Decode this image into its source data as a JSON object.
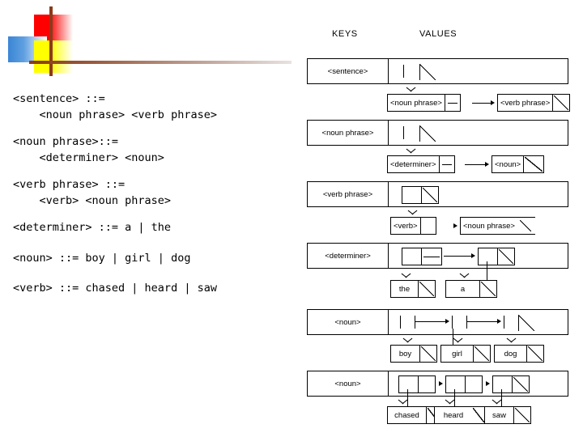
{
  "slide": {
    "logo": {
      "name": "decorative-logo",
      "colors": {
        "red": "#ff0000",
        "blue": "#3a86d6",
        "yellow": "#ffff00",
        "brown": "#8c3a1b"
      }
    },
    "grammar": {
      "title": "BNF grammar rules",
      "rules": [
        {
          "head": "<sentence> ::=",
          "body": "    <noun phrase> <verb phrase>"
        },
        {
          "head": "<noun phrase>::=",
          "body": "    <determiner> <noun>"
        },
        {
          "head": "<verb phrase> ::=",
          "body": "    <verb> <noun phrase>"
        },
        {
          "head": "<determiner> ::= a | the",
          "body": ""
        },
        {
          "head": "<noun> ::= boy | girl | dog",
          "body": ""
        },
        {
          "head": "<verb> ::= chased | heard | saw",
          "body": ""
        }
      ]
    },
    "diagram": {
      "headers": {
        "keys": "KEYS",
        "values": "VALUES"
      },
      "entries": [
        {
          "key": "<sentence>",
          "expansion": [
            "<noun phrase>",
            "<verb phrase>"
          ]
        },
        {
          "key": "<noun phrase>",
          "expansion": [
            "<determiner>",
            "<noun>"
          ]
        },
        {
          "key": "<verb phrase>",
          "expansion": [
            "<verb>",
            "<noun phrase>"
          ]
        },
        {
          "key": "<determiner>",
          "expansion": [
            "the",
            "a"
          ]
        },
        {
          "key": "<noun>",
          "expansion": [
            "boy",
            "girl",
            "dog"
          ]
        },
        {
          "key": "<noun>",
          "expansion": [
            "chased",
            "heard",
            "saw"
          ]
        }
      ]
    }
  }
}
